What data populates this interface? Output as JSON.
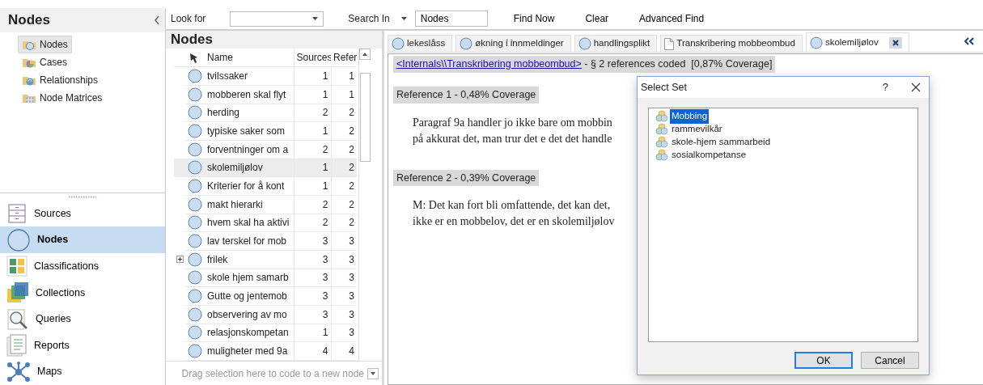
{
  "nav_pane": {
    "title": "Nodes",
    "tree": [
      {
        "label": "Nodes",
        "kind": "nodes",
        "selected": true
      },
      {
        "label": "Cases",
        "kind": "cases",
        "selected": false
      },
      {
        "label": "Relationships",
        "kind": "relationships",
        "selected": false
      },
      {
        "label": "Node Matrices",
        "kind": "matrices",
        "selected": false
      }
    ],
    "buttons": [
      {
        "label": "Sources",
        "kind": "sources",
        "selected": false
      },
      {
        "label": "Nodes",
        "kind": "nodes",
        "selected": true
      },
      {
        "label": "Classifications",
        "kind": "classifications",
        "selected": false
      },
      {
        "label": "Collections",
        "kind": "collections",
        "selected": false
      },
      {
        "label": "Queries",
        "kind": "queries",
        "selected": false
      },
      {
        "label": "Reports",
        "kind": "reports",
        "selected": false
      },
      {
        "label": "Maps",
        "kind": "maps",
        "selected": false
      }
    ]
  },
  "find_bar": {
    "look_for_label": "Look for",
    "search_in_label": "Search In",
    "search_in_value": "Nodes",
    "actions": [
      "Find Now",
      "Clear",
      "Advanced Find"
    ]
  },
  "node_list": {
    "title": "Nodes",
    "columns": [
      "Name",
      "Sources",
      "Refer"
    ],
    "rows": [
      {
        "name": "tvilssaker",
        "sources": "1",
        "references": "1",
        "expandable": false,
        "selected": false
      },
      {
        "name": "mobberen skal flyt",
        "sources": "1",
        "references": "1",
        "expandable": false,
        "selected": false
      },
      {
        "name": "herding",
        "sources": "2",
        "references": "2",
        "expandable": false,
        "selected": false
      },
      {
        "name": "typiske saker som",
        "sources": "1",
        "references": "2",
        "expandable": false,
        "selected": false
      },
      {
        "name": "forventninger om a",
        "sources": "2",
        "references": "2",
        "expandable": false,
        "selected": false
      },
      {
        "name": "skolemiljølov",
        "sources": "1",
        "references": "2",
        "expandable": false,
        "selected": true
      },
      {
        "name": "Kriterier for å kont",
        "sources": "1",
        "references": "2",
        "expandable": false,
        "selected": false
      },
      {
        "name": "makt hierarki",
        "sources": "2",
        "references": "2",
        "expandable": false,
        "selected": false
      },
      {
        "name": "hvem skal ha aktivi",
        "sources": "2",
        "references": "2",
        "expandable": false,
        "selected": false
      },
      {
        "name": "lav terskel for mob",
        "sources": "3",
        "references": "3",
        "expandable": false,
        "selected": false
      },
      {
        "name": "frilek",
        "sources": "3",
        "references": "3",
        "expandable": true,
        "selected": false
      },
      {
        "name": "skole hjem samarb",
        "sources": "3",
        "references": "3",
        "expandable": false,
        "selected": false
      },
      {
        "name": "Gutte og jentemob",
        "sources": "3",
        "references": "3",
        "expandable": false,
        "selected": false
      },
      {
        "name": "observering av mo",
        "sources": "3",
        "references": "3",
        "expandable": false,
        "selected": false
      },
      {
        "name": "relasjonskompetan",
        "sources": "1",
        "references": "3",
        "expandable": false,
        "selected": false
      },
      {
        "name": "muligheter med 9a",
        "sources": "4",
        "references": "4",
        "expandable": false,
        "selected": false
      }
    ],
    "drop_hint": "Drag selection here to code to a new node"
  },
  "tabs": [
    {
      "label": "lekeslåss",
      "kind": "node",
      "selected": false
    },
    {
      "label": "økning i innmeldinger",
      "kind": "node",
      "selected": false
    },
    {
      "label": "handlingsplikt",
      "kind": "node",
      "selected": false
    },
    {
      "label": "Transkribering mobbeombud",
      "kind": "document",
      "selected": false
    },
    {
      "label": "skolemiljølov",
      "kind": "node",
      "selected": true
    }
  ],
  "detail": {
    "source_link": "<Internals\\\\Transkribering mobbeombud>",
    "summary": " - § 2 references coded  [0,87% Coverage]",
    "references": [
      {
        "heading": "Reference 1 - 0,48% Coverage",
        "lines": [
          "Paragraf 9a handler jo ikke bare om mobbin",
          "på akkurat det, man trur det e det det handle"
        ]
      },
      {
        "heading": "Reference 2 - 0,39% Coverage",
        "lines": [
          "M: Det kan fort bli omfattende, det kan det,",
          "ikke er en mobbelov, det er en skolemiljølov"
        ]
      }
    ]
  },
  "dialog": {
    "title": "Select Set",
    "help": "?",
    "items": [
      {
        "label": "Mobbing",
        "selected": true
      },
      {
        "label": "rammevilkår",
        "selected": false
      },
      {
        "label": "skole-hjem sammarbeid",
        "selected": false
      },
      {
        "label": "sosialkompetanse",
        "selected": false
      }
    ],
    "buttons": [
      {
        "label": "OK",
        "default": true
      },
      {
        "label": "Cancel",
        "default": false
      }
    ]
  }
}
